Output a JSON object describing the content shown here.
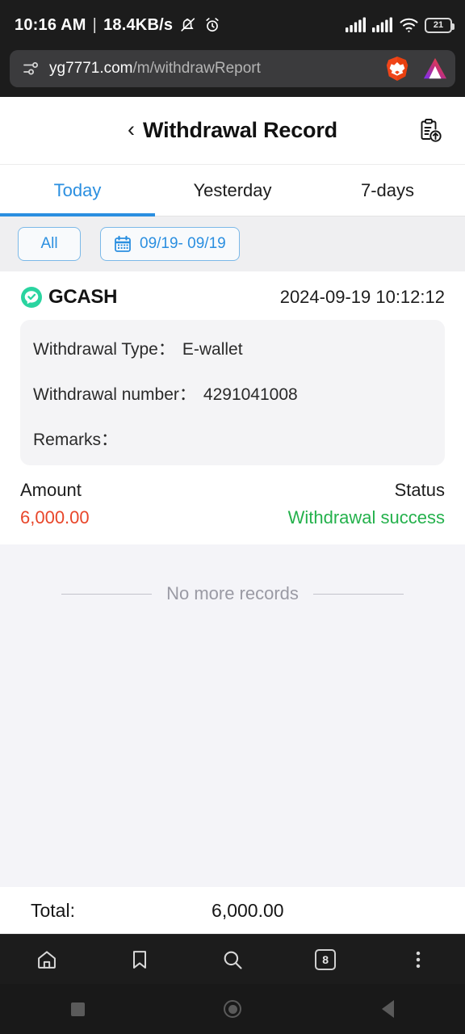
{
  "status_bar": {
    "time": "10:16 AM",
    "separator": "|",
    "network_speed": "18.4KB/s",
    "mute_icon": "bell-muted-icon",
    "alarm_icon": "alarm-clock-icon",
    "signal_icon": "signal-bars-icon",
    "wifi_icon": "wifi-icon",
    "battery_level": "21"
  },
  "browser": {
    "tune_icon": "tune-sliders-icon",
    "url_host": "yg7771.com",
    "url_path": "/m/withdrawReport",
    "brave_icon": "brave-lion-icon",
    "bat_icon": "bat-triangle-icon",
    "bottom": {
      "home_icon": "home-icon",
      "bookmark_icon": "bookmark-icon",
      "search_icon": "search-icon",
      "tab_count": "8",
      "menu_icon": "more-vertical-icon"
    }
  },
  "app_header": {
    "back_icon": "back-chevron-icon",
    "title": "Withdrawal Record",
    "action_icon": "clipboard-export-icon"
  },
  "tabs": {
    "items": [
      {
        "label": "Today",
        "active": true
      },
      {
        "label": "Yesterday",
        "active": false
      },
      {
        "label": "7-days",
        "active": false
      }
    ]
  },
  "filters": {
    "all_label": "All",
    "calendar_icon": "calendar-icon",
    "date_range": "09/19- 09/19"
  },
  "records": [
    {
      "brand_icon": "gcash-logo-icon",
      "brand": "GCASH",
      "timestamp": "2024-09-19 10:12:12",
      "details": [
        {
          "label": "Withdrawal Type：",
          "value": "E-wallet"
        },
        {
          "label": "Withdrawal number：",
          "value": "4291041008"
        },
        {
          "label": "Remarks：",
          "value": ""
        }
      ],
      "amount_label": "Amount",
      "amount_value": "6,000.00",
      "status_label": "Status",
      "status_value": "Withdrawal success"
    }
  ],
  "footer": {
    "no_more_text": "No more records",
    "total_label": "Total:",
    "total_value": "6,000.00"
  },
  "colors": {
    "accent_blue": "#2b8fe0",
    "amount_red": "#e8462a",
    "status_green": "#24b14c",
    "gcash_green": "#2ad4a0",
    "page_bg": "#f4f4f8"
  }
}
